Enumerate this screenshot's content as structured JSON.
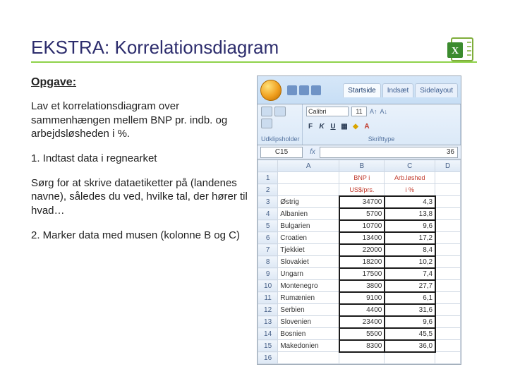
{
  "title": "EKSTRA: Korrelationsdiagram",
  "subhead": "Opgave:",
  "intro": "Lav et korrelationsdiagram over sammenhængen mellem BNP pr. indb. og arbejdsløsheden i %.",
  "step1": "1. Indtast data i regnearket",
  "step1_body": "Sørg for at skrive dataetiketter på (landenes navne), således du ved, hvilke tal, der hører til hvad…",
  "step2": "2. Marker data med musen (kolonne B og C)",
  "excel": {
    "tabs": {
      "t1": "Startside",
      "t2": "Indsæt",
      "t3": "Sidelayout"
    },
    "font": {
      "name": "Calibri",
      "size": "11"
    },
    "bold": "F",
    "italic": "K",
    "under": "U",
    "group1": "Udklipsholder",
    "group2": "Skrifttype",
    "namebox": "C15",
    "fx_label": "fx",
    "formula_val": "36",
    "cols": {
      "A": "A",
      "B": "B",
      "C": "C",
      "D": "D"
    },
    "hdr": {
      "b1": "BNP i",
      "b2": "US$/prs.",
      "c1": "Arb.løshed",
      "c2": "i %"
    },
    "rows": [
      {
        "n": "1",
        "a": "",
        "b": "",
        "c": ""
      },
      {
        "n": "2",
        "a": "",
        "b": "",
        "c": ""
      },
      {
        "n": "3",
        "a": "Østrig",
        "b": "34700",
        "c": "4,3"
      },
      {
        "n": "4",
        "a": "Albanien",
        "b": "5700",
        "c": "13,8"
      },
      {
        "n": "5",
        "a": "Bulgarien",
        "b": "10700",
        "c": "9,6"
      },
      {
        "n": "6",
        "a": "Croatien",
        "b": "13400",
        "c": "17,2"
      },
      {
        "n": "7",
        "a": "Tjekkiet",
        "b": "22000",
        "c": "8,4"
      },
      {
        "n": "8",
        "a": "Slovakiet",
        "b": "18200",
        "c": "10,2"
      },
      {
        "n": "9",
        "a": "Ungarn",
        "b": "17500",
        "c": "7,4"
      },
      {
        "n": "10",
        "a": "Montenegro",
        "b": "3800",
        "c": "27,7"
      },
      {
        "n": "11",
        "a": "Rumænien",
        "b": "9100",
        "c": "6,1"
      },
      {
        "n": "12",
        "a": "Serbien",
        "b": "4400",
        "c": "31,6"
      },
      {
        "n": "13",
        "a": "Slovenien",
        "b": "23400",
        "c": "9,6"
      },
      {
        "n": "14",
        "a": "Bosnien",
        "b": "5500",
        "c": "45,5"
      },
      {
        "n": "15",
        "a": "Makedonien",
        "b": "8300",
        "c": "36,0"
      },
      {
        "n": "16",
        "a": "",
        "b": "",
        "c": ""
      }
    ]
  }
}
